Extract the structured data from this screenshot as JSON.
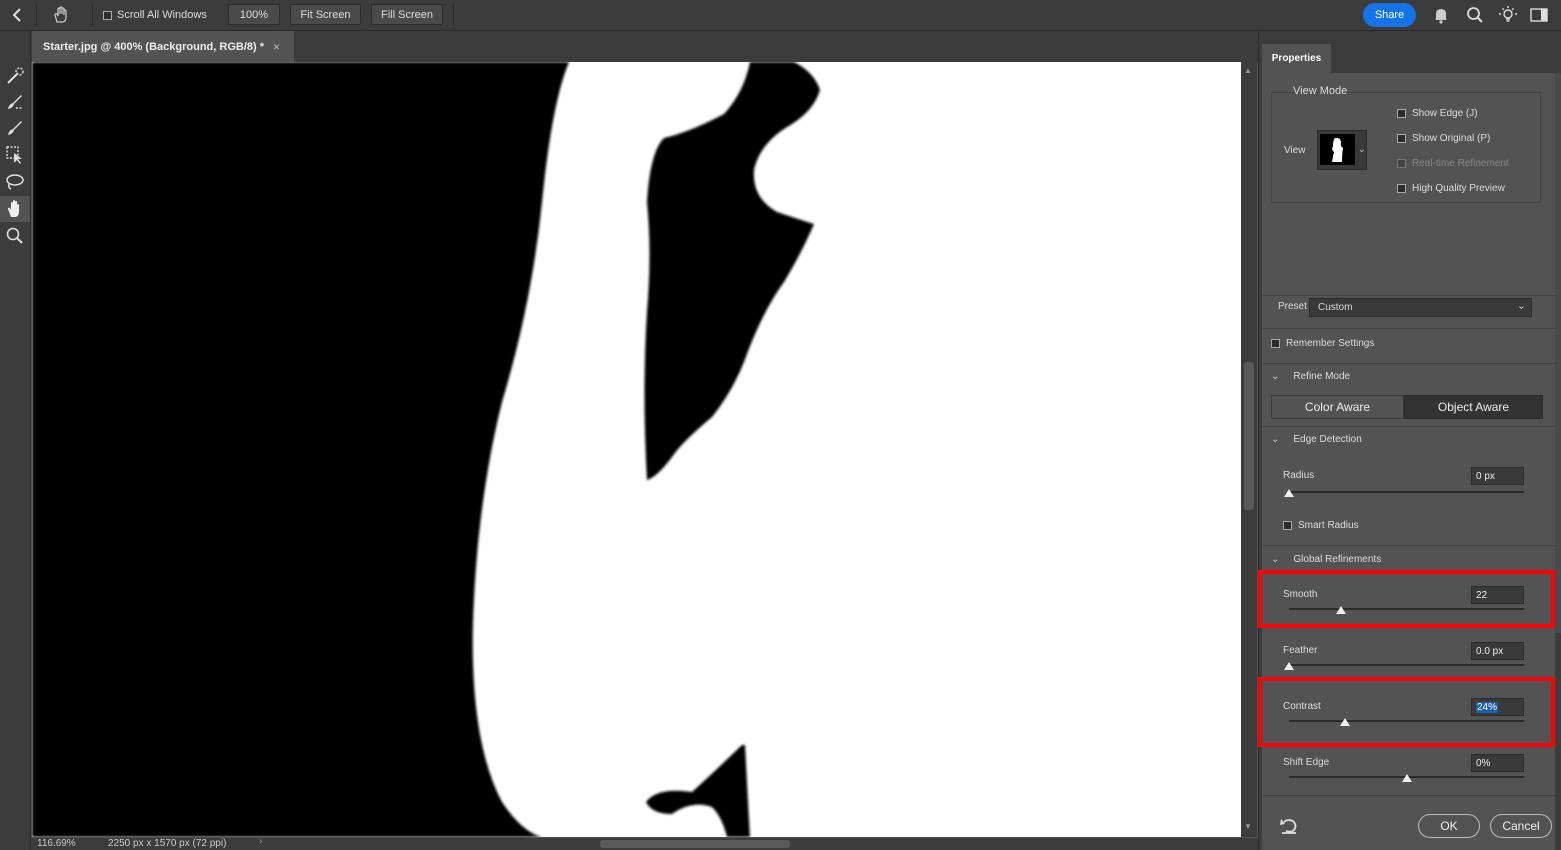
{
  "topbar": {
    "scroll_all_windows": "Scroll All Windows",
    "zoom_100": "100%",
    "fit_screen": "Fit Screen",
    "fill_screen": "Fill Screen",
    "share": "Share"
  },
  "document": {
    "tab_title": "Starter.jpg @ 400% (Background, RGB/8) *",
    "close": "×"
  },
  "status": {
    "zoom": "116.69%",
    "dimensions": "2250 px x 1570 px (72 ppi)"
  },
  "properties": {
    "tab": "Properties",
    "view_mode": {
      "title": "View Mode",
      "view_label": "View",
      "options": [
        {
          "label": "Show Edge (J)",
          "checked": false,
          "disabled": false
        },
        {
          "label": "Show Original (P)",
          "checked": false,
          "disabled": false
        },
        {
          "label": "Real-time Refinement",
          "checked": true,
          "disabled": true
        },
        {
          "label": "High Quality Preview",
          "checked": false,
          "disabled": false
        }
      ]
    },
    "preset": {
      "label": "Preset",
      "value": "Custom"
    },
    "remember_settings": "Remember Settings",
    "refine_mode": {
      "title": "Refine Mode",
      "color_aware": "Color Aware",
      "object_aware": "Object Aware",
      "selected": "Object Aware"
    },
    "edge_detection": {
      "title": "Edge Detection",
      "radius_label": "Radius",
      "radius_value": "0 px",
      "radius_level": 0,
      "smart_radius": "Smart Radius"
    },
    "global_refinements": {
      "title": "Global Refinements",
      "smooth_label": "Smooth",
      "smooth_value": "22",
      "smooth_level": 0.22,
      "feather_label": "Feather",
      "feather_value": "0.0 px",
      "feather_level": 0,
      "contrast_label": "Contrast",
      "contrast_value": "24%",
      "contrast_level": 0.24,
      "shift_edge_label": "Shift Edge",
      "shift_edge_value": "0%",
      "shift_edge_level": 0.5
    },
    "ok": "OK",
    "cancel": "Cancel"
  },
  "colors": {
    "accent": "#1473e6",
    "highlight": "#ff0000",
    "selection_bg": "#1e5fa8"
  }
}
